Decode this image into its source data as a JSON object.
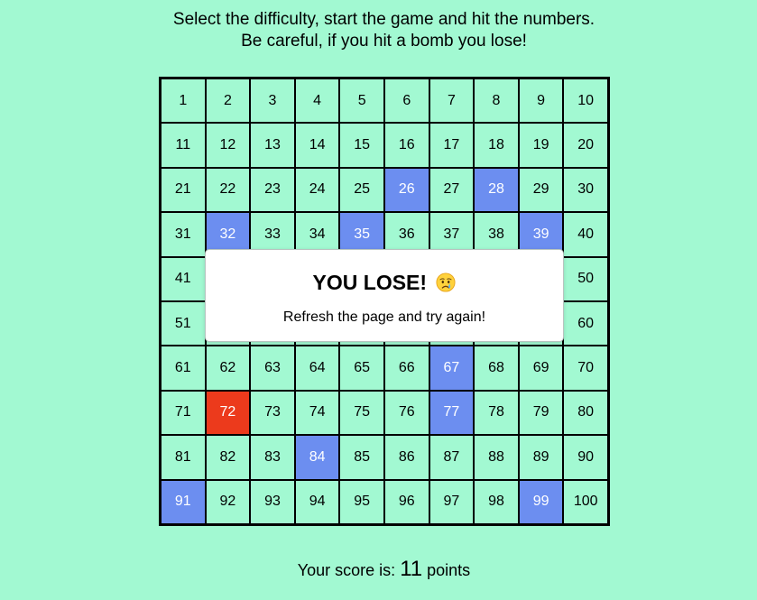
{
  "instructions": {
    "line1": "Select the difficulty, start the game and hit the numbers.",
    "line2": "Be careful, if you hit a bomb you lose!"
  },
  "grid": {
    "size": 100,
    "clicked": [
      26,
      28,
      32,
      35,
      39,
      67,
      77,
      84,
      91,
      99
    ],
    "bomb": [
      72
    ],
    "colors": {
      "cell": "#a2f9d2",
      "clicked": "#6c8ef0",
      "bomb": "#ec3a1c",
      "border": "#000000"
    }
  },
  "modal": {
    "title": "YOU LOSE!",
    "icon": "crying-face-icon",
    "message": "Refresh the page and try again!"
  },
  "score": {
    "prefix": "Your score is:",
    "value": "11",
    "suffix": "points"
  }
}
